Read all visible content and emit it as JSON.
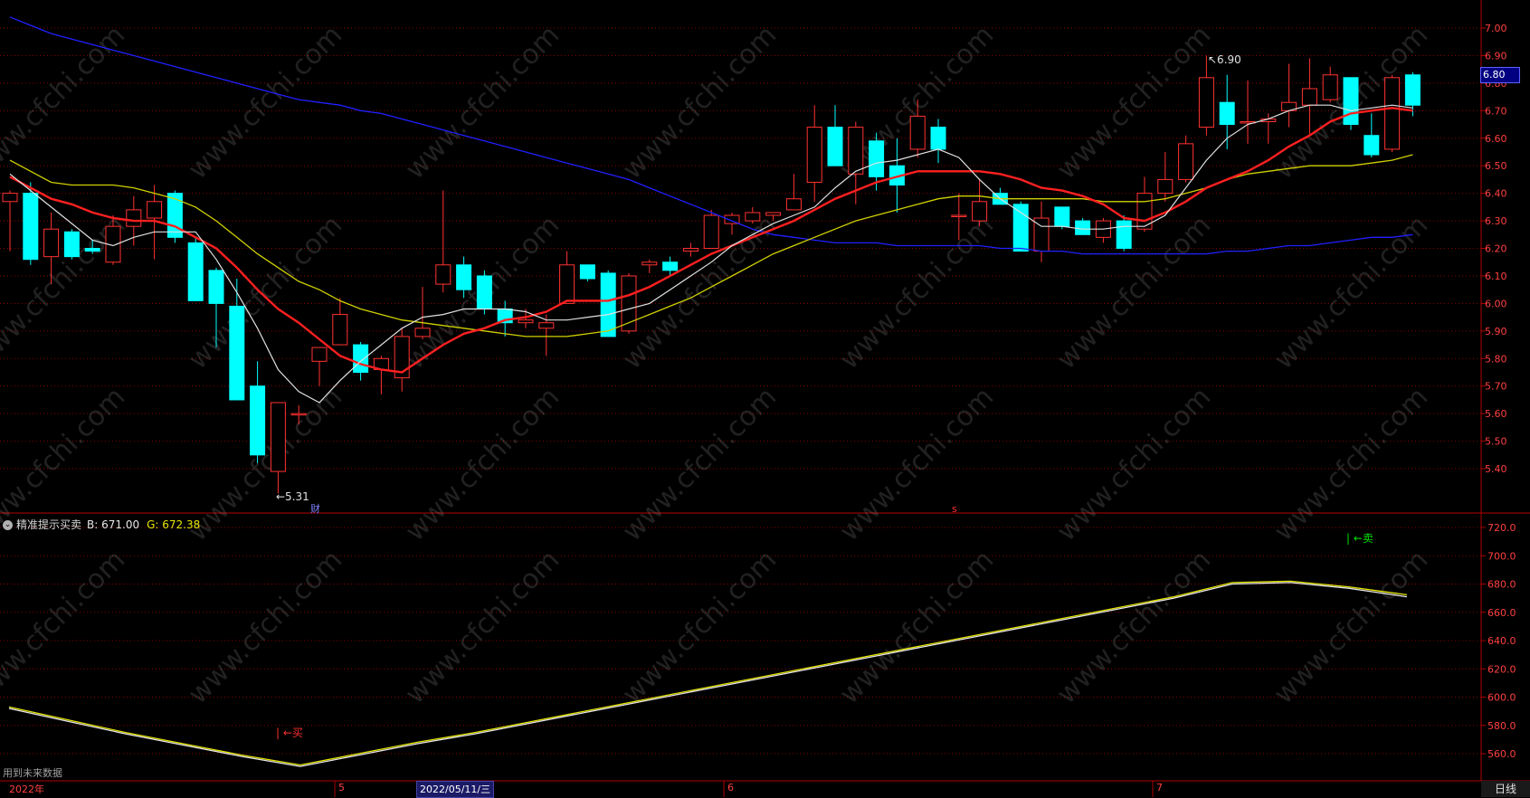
{
  "chart_data": {
    "type": "candlestick",
    "price_panel": {
      "ylim": [
        5.31,
        7.04
      ],
      "y_ticks": [
        "7.00",
        "6.90",
        "6.80",
        "6.70",
        "6.60",
        "6.50",
        "6.40",
        "6.30",
        "6.20",
        "6.10",
        "6.00",
        "5.90",
        "5.80",
        "5.70",
        "5.60",
        "5.50",
        "5.40"
      ],
      "current_price": "6.80",
      "high_marker": "6.90",
      "low_marker": "5.31",
      "candles": [
        {
          "o": 6.37,
          "h": 6.41,
          "l": 6.19,
          "c": 6.4
        },
        {
          "o": 6.4,
          "h": 6.44,
          "l": 6.14,
          "c": 6.16
        },
        {
          "o": 6.17,
          "h": 6.33,
          "l": 6.07,
          "c": 6.27
        },
        {
          "o": 6.26,
          "h": 6.27,
          "l": 6.16,
          "c": 6.17
        },
        {
          "o": 6.2,
          "h": 6.23,
          "l": 6.18,
          "c": 6.19
        },
        {
          "o": 6.15,
          "h": 6.32,
          "l": 6.14,
          "c": 6.28
        },
        {
          "o": 6.28,
          "h": 6.39,
          "l": 6.21,
          "c": 6.34
        },
        {
          "o": 6.31,
          "h": 6.43,
          "l": 6.16,
          "c": 6.37
        },
        {
          "o": 6.4,
          "h": 6.41,
          "l": 6.22,
          "c": 6.24
        },
        {
          "o": 6.22,
          "h": 6.24,
          "l": 6.01,
          "c": 6.01
        },
        {
          "o": 6.12,
          "h": 6.13,
          "l": 5.84,
          "c": 6.0
        },
        {
          "o": 5.99,
          "h": 6.09,
          "l": 5.65,
          "c": 5.65
        },
        {
          "o": 5.7,
          "h": 5.79,
          "l": 5.42,
          "c": 5.45
        },
        {
          "o": 5.39,
          "h": 5.64,
          "l": 5.31,
          "c": 5.64
        },
        {
          "o": 5.6,
          "h": 5.63,
          "l": 5.56,
          "c": 5.6
        },
        {
          "o": 5.79,
          "h": 5.84,
          "l": 5.7,
          "c": 5.84
        },
        {
          "o": 5.85,
          "h": 6.02,
          "l": 5.85,
          "c": 5.96
        },
        {
          "o": 5.85,
          "h": 5.86,
          "l": 5.72,
          "c": 5.75
        },
        {
          "o": 5.76,
          "h": 5.81,
          "l": 5.67,
          "c": 5.8
        },
        {
          "o": 5.73,
          "h": 5.91,
          "l": 5.68,
          "c": 5.88
        },
        {
          "o": 5.88,
          "h": 6.06,
          "l": 5.87,
          "c": 5.91
        },
        {
          "o": 6.07,
          "h": 6.41,
          "l": 6.04,
          "c": 6.14
        },
        {
          "o": 6.14,
          "h": 6.17,
          "l": 6.02,
          "c": 6.05
        },
        {
          "o": 6.1,
          "h": 6.12,
          "l": 5.96,
          "c": 5.98
        },
        {
          "o": 5.98,
          "h": 6.01,
          "l": 5.88,
          "c": 5.93
        },
        {
          "o": 5.93,
          "h": 5.98,
          "l": 5.91,
          "c": 5.94
        },
        {
          "o": 5.91,
          "h": 5.96,
          "l": 5.81,
          "c": 5.93
        },
        {
          "o": 6.0,
          "h": 6.19,
          "l": 6.0,
          "c": 6.14
        },
        {
          "o": 6.14,
          "h": 6.13,
          "l": 6.08,
          "c": 6.09
        },
        {
          "o": 6.11,
          "h": 6.12,
          "l": 5.88,
          "c": 5.88
        },
        {
          "o": 5.9,
          "h": 6.11,
          "l": 5.89,
          "c": 6.1
        },
        {
          "o": 6.14,
          "h": 6.16,
          "l": 6.11,
          "c": 6.15
        },
        {
          "o": 6.15,
          "h": 6.17,
          "l": 6.1,
          "c": 6.12
        },
        {
          "o": 6.19,
          "h": 6.22,
          "l": 6.17,
          "c": 6.2
        },
        {
          "o": 6.2,
          "h": 6.34,
          "l": 6.2,
          "c": 6.32
        },
        {
          "o": 6.29,
          "h": 6.33,
          "l": 6.25,
          "c": 6.32
        },
        {
          "o": 6.3,
          "h": 6.35,
          "l": 6.29,
          "c": 6.33
        },
        {
          "o": 6.32,
          "h": 6.33,
          "l": 6.3,
          "c": 6.33
        },
        {
          "o": 6.34,
          "h": 6.47,
          "l": 6.34,
          "c": 6.38
        },
        {
          "o": 6.44,
          "h": 6.72,
          "l": 6.37,
          "c": 6.64
        },
        {
          "o": 6.64,
          "h": 6.72,
          "l": 6.5,
          "c": 6.5
        },
        {
          "o": 6.47,
          "h": 6.66,
          "l": 6.36,
          "c": 6.64
        },
        {
          "o": 6.59,
          "h": 6.62,
          "l": 6.41,
          "c": 6.46
        },
        {
          "o": 6.5,
          "h": 6.6,
          "l": 6.33,
          "c": 6.43
        },
        {
          "o": 6.56,
          "h": 6.74,
          "l": 6.53,
          "c": 6.68
        },
        {
          "o": 6.64,
          "h": 6.67,
          "l": 6.51,
          "c": 6.56
        },
        {
          "o": 6.32,
          "h": 6.4,
          "l": 6.23,
          "c": 6.32
        },
        {
          "o": 6.3,
          "h": 6.45,
          "l": 6.28,
          "c": 6.37
        },
        {
          "o": 6.4,
          "h": 6.42,
          "l": 6.36,
          "c": 6.36
        },
        {
          "o": 6.36,
          "h": 6.37,
          "l": 6.19,
          "c": 6.19
        },
        {
          "o": 6.19,
          "h": 6.37,
          "l": 6.15,
          "c": 6.31
        },
        {
          "o": 6.35,
          "h": 6.35,
          "l": 6.27,
          "c": 6.28
        },
        {
          "o": 6.3,
          "h": 6.31,
          "l": 6.25,
          "c": 6.25
        },
        {
          "o": 6.24,
          "h": 6.31,
          "l": 6.22,
          "c": 6.3
        },
        {
          "o": 6.3,
          "h": 6.32,
          "l": 6.19,
          "c": 6.2
        },
        {
          "o": 6.27,
          "h": 6.46,
          "l": 6.26,
          "c": 6.4
        },
        {
          "o": 6.4,
          "h": 6.55,
          "l": 6.37,
          "c": 6.45
        },
        {
          "o": 6.45,
          "h": 6.61,
          "l": 6.44,
          "c": 6.58
        },
        {
          "o": 6.64,
          "h": 6.9,
          "l": 6.61,
          "c": 6.82
        },
        {
          "o": 6.73,
          "h": 6.83,
          "l": 6.56,
          "c": 6.65
        },
        {
          "o": 6.66,
          "h": 6.81,
          "l": 6.58,
          "c": 6.66
        },
        {
          "o": 6.66,
          "h": 6.69,
          "l": 6.58,
          "c": 6.67
        },
        {
          "o": 6.7,
          "h": 6.87,
          "l": 6.64,
          "c": 6.73
        },
        {
          "o": 6.72,
          "h": 6.89,
          "l": 6.61,
          "c": 6.78
        },
        {
          "o": 6.74,
          "h": 6.86,
          "l": 6.73,
          "c": 6.83
        },
        {
          "o": 6.82,
          "h": 6.82,
          "l": 6.63,
          "c": 6.65
        },
        {
          "o": 6.61,
          "h": 6.69,
          "l": 6.53,
          "c": 6.54
        },
        {
          "o": 6.56,
          "h": 6.83,
          "l": 6.55,
          "c": 6.82
        },
        {
          "o": 6.83,
          "h": 6.84,
          "l": 6.68,
          "c": 6.72
        }
      ],
      "ma_white": [
        6.47,
        6.41,
        6.35,
        6.29,
        6.23,
        6.21,
        6.24,
        6.26,
        6.26,
        6.26,
        6.16,
        6.04,
        5.91,
        5.76,
        5.68,
        5.64,
        5.72,
        5.79,
        5.85,
        5.91,
        5.95,
        5.96,
        5.98,
        5.98,
        5.98,
        5.97,
        5.94,
        5.94,
        5.95,
        5.96,
        5.98,
        6.0,
        6.05,
        6.1,
        6.15,
        6.21,
        6.25,
        6.29,
        6.32,
        6.35,
        6.42,
        6.48,
        6.51,
        6.52,
        6.54,
        6.56,
        6.53,
        6.45,
        6.38,
        6.33,
        6.28,
        6.28,
        6.27,
        6.27,
        6.28,
        6.28,
        6.32,
        6.42,
        6.52,
        6.6,
        6.65,
        6.67,
        6.7,
        6.72,
        6.72,
        6.7,
        6.71,
        6.72,
        6.71
      ],
      "ma_red": [
        6.46,
        6.42,
        6.38,
        6.36,
        6.33,
        6.31,
        6.3,
        6.3,
        6.28,
        6.24,
        6.2,
        6.13,
        6.05,
        5.98,
        5.93,
        5.87,
        5.81,
        5.78,
        5.76,
        5.75,
        5.8,
        5.85,
        5.89,
        5.91,
        5.94,
        5.95,
        5.97,
        6.01,
        6.01,
        6.01,
        6.03,
        6.06,
        6.1,
        6.14,
        6.18,
        6.21,
        6.24,
        6.27,
        6.3,
        6.34,
        6.38,
        6.41,
        6.44,
        6.46,
        6.48,
        6.48,
        6.48,
        6.48,
        6.47,
        6.45,
        6.42,
        6.41,
        6.39,
        6.36,
        6.31,
        6.3,
        6.33,
        6.37,
        6.42,
        6.45,
        6.48,
        6.52,
        6.57,
        6.61,
        6.66,
        6.69,
        6.7,
        6.71,
        6.7
      ],
      "ma_yellow": [
        6.52,
        6.48,
        6.44,
        6.43,
        6.43,
        6.43,
        6.42,
        6.4,
        6.38,
        6.35,
        6.3,
        6.24,
        6.18,
        6.13,
        6.08,
        6.05,
        6.01,
        5.98,
        5.96,
        5.94,
        5.93,
        5.92,
        5.91,
        5.9,
        5.89,
        5.88,
        5.88,
        5.88,
        5.89,
        5.9,
        5.93,
        5.96,
        5.99,
        6.02,
        6.06,
        6.1,
        6.14,
        6.18,
        6.21,
        6.24,
        6.27,
        6.3,
        6.32,
        6.34,
        6.36,
        6.38,
        6.39,
        6.39,
        6.38,
        6.38,
        6.38,
        6.38,
        6.38,
        6.37,
        6.37,
        6.37,
        6.38,
        6.4,
        6.42,
        6.45,
        6.47,
        6.48,
        6.49,
        6.5,
        6.5,
        6.5,
        6.51,
        6.52,
        6.54
      ],
      "ma_blue": [
        7.04,
        7.01,
        6.98,
        6.96,
        6.94,
        6.92,
        6.9,
        6.88,
        6.86,
        6.84,
        6.82,
        6.8,
        6.78,
        6.76,
        6.74,
        6.73,
        6.72,
        6.7,
        6.69,
        6.67,
        6.65,
        6.63,
        6.61,
        6.59,
        6.57,
        6.55,
        6.53,
        6.51,
        6.49,
        6.47,
        6.45,
        6.42,
        6.39,
        6.36,
        6.33,
        6.3,
        6.27,
        6.25,
        6.24,
        6.23,
        6.22,
        6.22,
        6.22,
        6.21,
        6.21,
        6.21,
        6.21,
        6.21,
        6.2,
        6.2,
        6.19,
        6.19,
        6.18,
        6.18,
        6.18,
        6.18,
        6.18,
        6.18,
        6.18,
        6.19,
        6.19,
        6.2,
        6.21,
        6.21,
        6.22,
        6.23,
        6.24,
        6.24,
        6.25
      ]
    },
    "indicator_panel": {
      "name": "精准提示买卖",
      "b_label": "B: 671.00",
      "g_label": "G: 672.38",
      "ylim": [
        550,
        730
      ],
      "y_ticks": [
        "720.0",
        "700.0",
        "680.0",
        "660.0",
        "640.0",
        "620.0",
        "600.0",
        "580.0",
        "560.0"
      ],
      "b_values": [
        592,
        583,
        574,
        566,
        558,
        551,
        559,
        567,
        574,
        582,
        590,
        598,
        606,
        614,
        622,
        630,
        638,
        646,
        654,
        662,
        670,
        680,
        681,
        677,
        671
      ],
      "g_values": [
        593,
        584,
        575,
        567,
        559,
        552,
        560,
        568,
        575,
        583,
        591,
        599,
        607,
        615,
        623,
        631,
        639,
        647,
        655,
        663,
        671,
        681,
        682,
        678,
        672.38
      ],
      "buy_signal": "买",
      "sell_signal": "卖"
    },
    "x_labels": [
      {
        "label": "2022年"
      },
      {
        "label": "5"
      },
      {
        "label": "6"
      },
      {
        "label": "7"
      }
    ],
    "selected_date": "2022/05/11/三"
  },
  "ui": {
    "future_data_note": "用到未来数据",
    "period": "日线",
    "finance_marker": "财",
    "s_marker": "s",
    "watermark": "www.cfchi.com",
    "colors": {
      "up": "#ff3232",
      "down": "#00ffff",
      "ma_white": "#e0e0e0",
      "ma_red": "#ff2020",
      "ma_yellow": "#d0d000",
      "ma_blue": "#2020ff",
      "grid": "#8b0000"
    }
  }
}
